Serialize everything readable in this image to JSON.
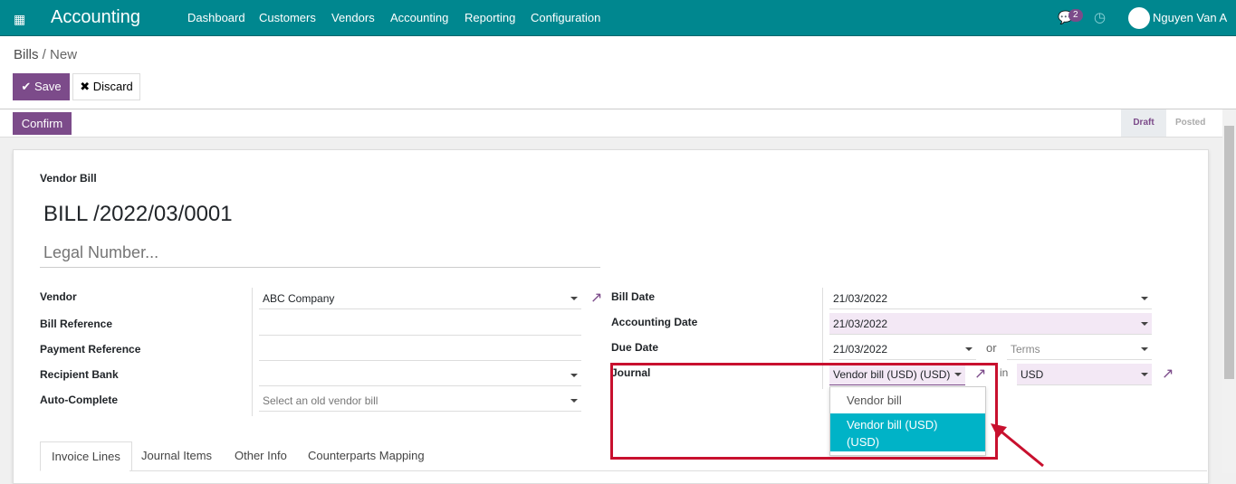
{
  "nav": {
    "app_title": "Accounting",
    "menu": [
      "Dashboard",
      "Customers",
      "Vendors",
      "Accounting",
      "Reporting",
      "Configuration"
    ],
    "message_count": "2",
    "user_name": "Nguyen Van A"
  },
  "breadcrumb": {
    "parent": "Bills",
    "current": "New"
  },
  "buttons": {
    "save": "Save",
    "discard": "Discard",
    "confirm": "Confirm"
  },
  "status": {
    "stages": [
      "Draft",
      "Posted"
    ],
    "active": "Draft"
  },
  "form": {
    "section_label": "Vendor Bill",
    "number": "BILL /2022/03/0001",
    "legal_number_placeholder": "Legal Number...",
    "left": [
      {
        "label": "Vendor",
        "value": "ABC Company"
      },
      {
        "label": "Bill Reference",
        "value": ""
      },
      {
        "label": "Payment Reference",
        "value": ""
      },
      {
        "label": "Recipient Bank",
        "value": ""
      },
      {
        "label": "Auto-Complete",
        "placeholder": "Select an old vendor bill"
      }
    ],
    "right": {
      "bill_date_label": "Bill Date",
      "bill_date": "21/03/2022",
      "accounting_date_label": "Accounting Date",
      "accounting_date": "21/03/2022",
      "due_date_label": "Due Date",
      "due_date": "21/03/2022",
      "or": "or",
      "terms_placeholder": "Terms",
      "journal_label": "Journal",
      "journal_value": "Vendor bill (USD) (USD)",
      "in": "in",
      "currency": "USD"
    },
    "journal_options": [
      "Vendor bill",
      "Vendor bill (USD) (USD)"
    ],
    "journal_highlighted": "Vendor bill (USD) (USD)"
  },
  "tabs": [
    "Invoice Lines",
    "Journal Items",
    "Other Info",
    "Counterparts Mapping"
  ],
  "colors": {
    "navbar": "#00878f",
    "primary": "#7c4b8a",
    "highlight": "#00b3c7",
    "annotation": "#c8102e"
  }
}
